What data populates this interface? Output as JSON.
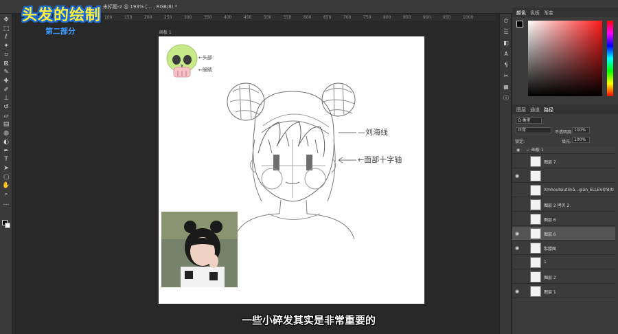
{
  "overlay": {
    "title": "头发的绘制",
    "subtitle": "第二部分",
    "caption": "一些小碎发其实是非常重要的"
  },
  "document": {
    "tab_title": "未标题-2 @ 193% (... , RGB/8) *",
    "artboard_label": "画板 1",
    "ruler_ticks": [
      "100",
      "150",
      "200",
      "250",
      "300",
      "350",
      "400",
      "450",
      "500",
      "550",
      "600",
      "650",
      "700",
      "750",
      "800",
      "850",
      "900",
      "950",
      "1000"
    ]
  },
  "canvas_notes": {
    "skull_note_1": "←头部",
    "skull_note_2": "←眼睛",
    "hair_note": "—刘海线",
    "face_note": "←面部十字轴"
  },
  "toolbar": {
    "tools": [
      "move-icon",
      "marquee-icon",
      "lasso-icon",
      "magic-wand-icon",
      "crop-icon",
      "frame-icon",
      "eyedropper-icon",
      "healing-icon",
      "brush-icon",
      "stamp-icon",
      "history-brush-icon",
      "eraser-icon",
      "gradient-icon",
      "blur-icon",
      "dodge-icon",
      "pen-icon",
      "type-icon",
      "path-select-icon",
      "shape-icon",
      "hand-icon",
      "zoom-icon",
      "more-icon"
    ]
  },
  "panels": {
    "color_tabs": [
      "颜色",
      "色板",
      "渐变"
    ],
    "layer_tabs": [
      "图层",
      "通道",
      "路径"
    ],
    "kind_filter": "Q 类型",
    "blend_mode": "正常",
    "opacity_label": "不透明度:",
    "opacity_value": "100%",
    "lock_label": "锁定:",
    "fill_label": "填充:",
    "fill_value": "100%",
    "colors": {
      "foreground": "#000000",
      "background": "#ffffff",
      "hue": "#ff1a1a"
    }
  },
  "layers": {
    "group_name": "画板 1",
    "items": [
      {
        "name": "图层 7",
        "visible": false,
        "selected": false
      },
      {
        "name": "",
        "visible": true,
        "selected": false
      },
      {
        "name": "Xmhoutsiutilnã...gián_ELLEVI(fd)tram",
        "visible": false,
        "selected": false
      },
      {
        "name": "图层 2 拷贝 2",
        "visible": false,
        "selected": false
      },
      {
        "name": "图层 6",
        "visible": false,
        "selected": false
      },
      {
        "name": "图层 6",
        "visible": true,
        "selected": true
      },
      {
        "name": "骷髅图",
        "visible": true,
        "selected": false
      },
      {
        "name": "1",
        "visible": false,
        "selected": false
      },
      {
        "name": "图层 2",
        "visible": false,
        "selected": false
      },
      {
        "name": "图层 1",
        "visible": true,
        "selected": false
      }
    ]
  }
}
